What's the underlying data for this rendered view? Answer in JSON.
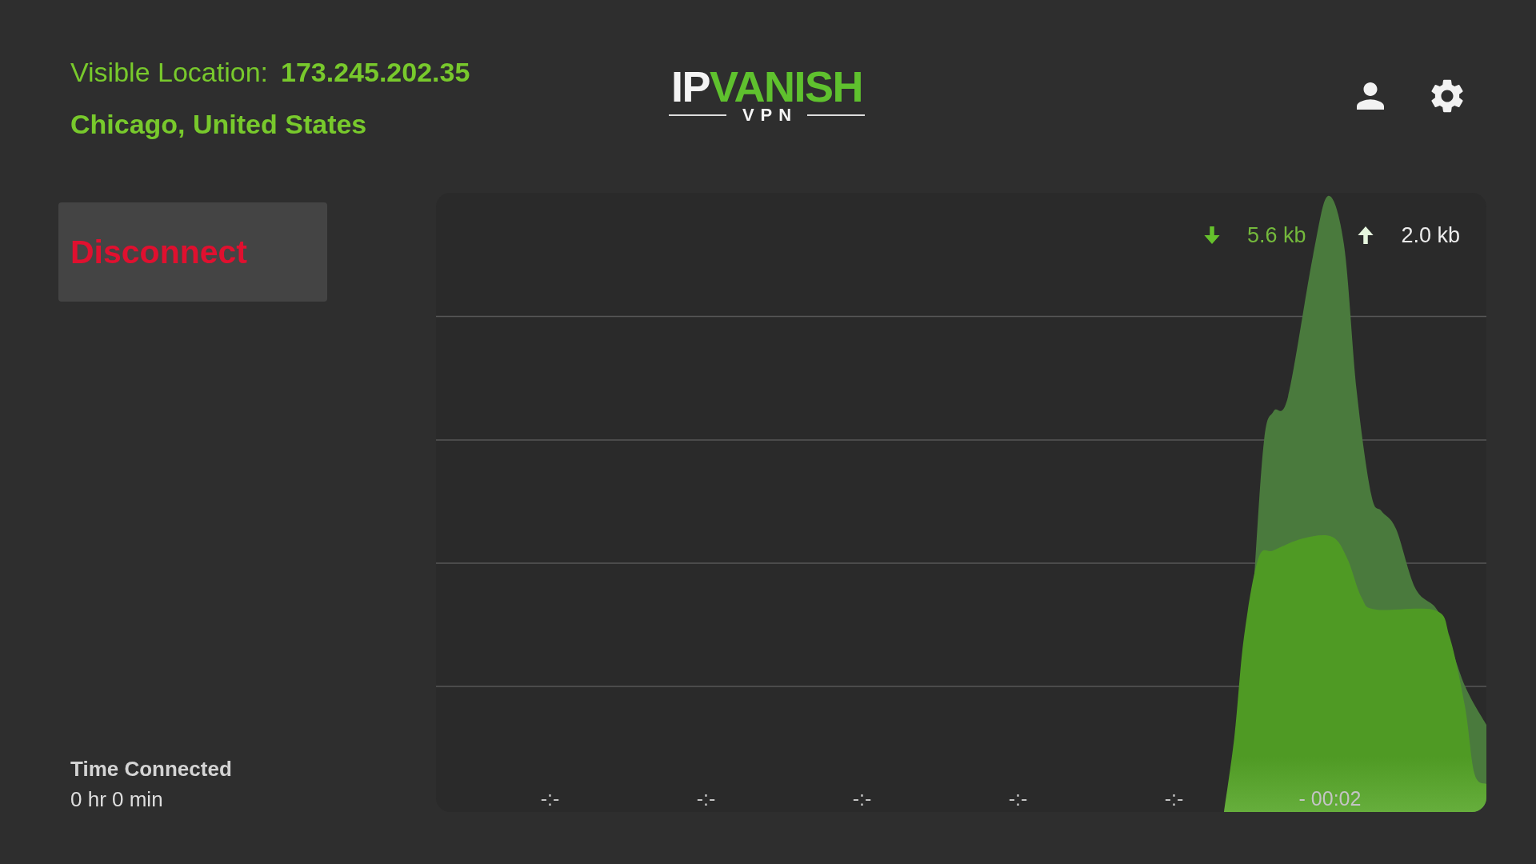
{
  "location": {
    "label": "Visible Location:",
    "ip": "173.245.202.35",
    "place": "Chicago, United States"
  },
  "logo": {
    "wordmark_first": "IP",
    "wordmark_second": "VANISH",
    "tagline": "VPN"
  },
  "disconnect_button": {
    "label": "Disconnect"
  },
  "time_connected": {
    "label": "Time Connected",
    "value": "0 hr 0 min"
  },
  "graph": {
    "legend": [
      {
        "kind": "download",
        "value": "5.6 kb"
      },
      {
        "kind": "upload",
        "value": "2.0 kb"
      }
    ],
    "x_labels": [
      "-:-",
      "-:-",
      "-:-",
      "-:-",
      "-:-",
      "- 00:02"
    ]
  }
}
